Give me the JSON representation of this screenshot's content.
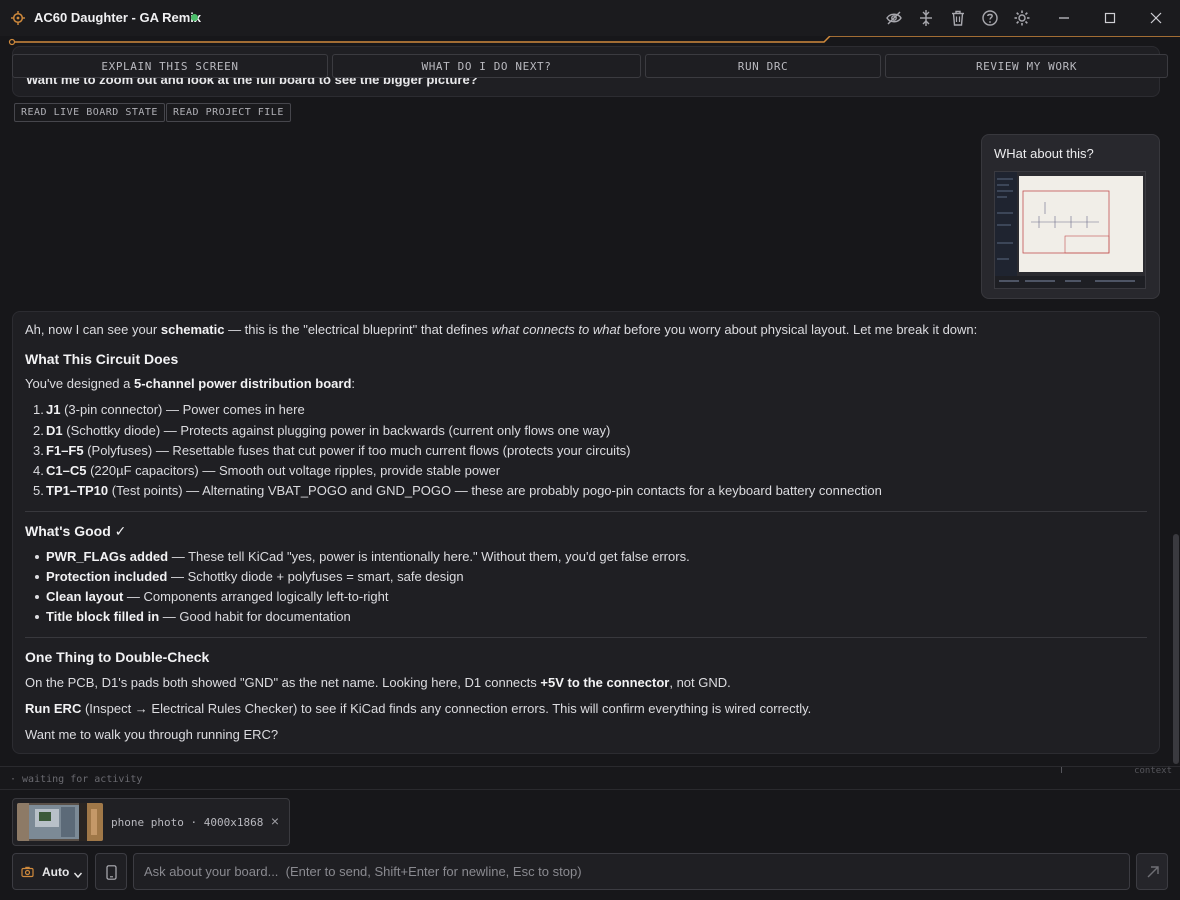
{
  "window": {
    "title": "AC60 Daughter - GA Remix",
    "accent": "#d08a3c",
    "status_color": "#4bbd6a"
  },
  "toolbar_icons": [
    "eye-off-icon",
    "collapse-icon",
    "trash-icon",
    "help-icon",
    "settings-icon"
  ],
  "quick_actions": [
    "EXPLAIN THIS SCREEN",
    "WHAT DO I DO NEXT?",
    "RUN DRC",
    "REVIEW MY WORK"
  ],
  "previous_message": {
    "text": "Want me to zoom out and look at the full board to see the bigger picture?"
  },
  "read_actions": [
    "READ LIVE BOARD STATE",
    "READ PROJECT FILE"
  ],
  "user_message": {
    "text": "WHat about this?"
  },
  "assistant": {
    "intro": {
      "p1": "Ah, now I can see your ",
      "b1": "schematic",
      "p2": " — this is the \"electrical blueprint\" that defines ",
      "i1": "what connects to what",
      "p3": " before you worry about physical layout. Let me break it down:"
    },
    "section1": {
      "heading": "What This Circuit Does",
      "lead_pre": "You've designed a ",
      "lead_bold": "5-channel power distribution board",
      "lead_post": ":",
      "items": [
        {
          "num": "1.",
          "bold": "J1",
          "rest": " (3-pin connector) — Power comes in here"
        },
        {
          "num": "2.",
          "bold": "D1",
          "rest": " (Schottky diode) — Protects against plugging power in backwards (current only flows one way)"
        },
        {
          "num": "3.",
          "bold": "F1–F5",
          "rest": " (Polyfuses) — Resettable fuses that cut power if too much current flows (protects your circuits)"
        },
        {
          "num": "4.",
          "bold": "C1–C5",
          "rest": " (220µF capacitors) — Smooth out voltage ripples, provide stable power"
        },
        {
          "num": "5.",
          "bold": "TP1–TP10",
          "rest": " (Test points) — Alternating VBAT_POGO and GND_POGO — these are probably pogo-pin contacts for a keyboard battery connection"
        }
      ]
    },
    "section2": {
      "heading": "What's Good ✓",
      "items": [
        {
          "bold": "PWR_FLAGs added",
          "rest": " — These tell KiCad \"yes, power is intentionally here.\" Without them, you'd get false errors."
        },
        {
          "bold": "Protection included",
          "rest": " — Schottky diode + polyfuses = smart, safe design"
        },
        {
          "bold": "Clean layout",
          "rest": " — Components arranged logically left-to-right"
        },
        {
          "bold": "Title block filled in",
          "rest": " — Good habit for documentation"
        }
      ]
    },
    "section3": {
      "heading": "One Thing to Double-Check",
      "p1_pre": "On the PCB, D1's pads both showed \"GND\" as the net name. Looking here, D1 connects ",
      "p1_bold": "+5V to the connector",
      "p1_post": ", not GND.",
      "p2_bold": "Run ERC",
      "p2_rest": " (Inspect → Electrical Rules Checker) to see if KiCad finds any connection errors. This will confirm everything is wired correctly.",
      "p3": "Want me to walk you through running ERC?"
    }
  },
  "activity": {
    "status": "· waiting for activity",
    "context_label": "context"
  },
  "attachment": {
    "label": "phone photo · 4000x1868",
    "remove": "×"
  },
  "input": {
    "mode": "Auto",
    "placeholder": "Ask about your board...  (Enter to send, Shift+Enter for newline, Esc to stop)"
  }
}
